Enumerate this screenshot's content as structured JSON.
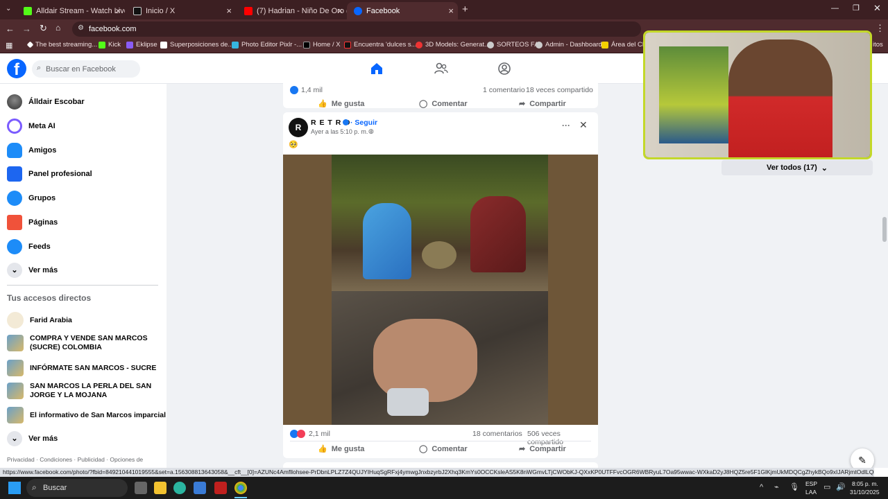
{
  "browser": {
    "tabs": [
      {
        "title": "Alldair Stream - Watch Live on",
        "color": "#53fc18"
      },
      {
        "title": "Inicio / X",
        "color": "#000000"
      },
      {
        "title": "(7) Hadrian - Niño De Oro (Vid",
        "color": "#ff0000"
      },
      {
        "title": "Facebook",
        "color": "#0866ff"
      }
    ],
    "new_tab": "+",
    "url": "facebook.com",
    "bookmarks": [
      "The best streaming...",
      "Kick",
      "Eklipse",
      "Superposiciones de...",
      "Photo Editor Pixlr -...",
      "Home / X",
      "Encuentra 'dulces s...",
      "3D Models: Generat...",
      "SORTEOS FA",
      "Admin - Dashboard",
      "Área del Clie"
    ],
    "bookmarks_overflow": "itos"
  },
  "fb": {
    "search_placeholder": "Buscar en Facebook",
    "nav": [
      "Álldair Escobar",
      "Meta AI",
      "Amigos",
      "Panel profesional",
      "Grupos",
      "Páginas",
      "Feeds",
      "Ver más"
    ],
    "shortcuts_title": "Tus accesos directos",
    "shortcuts": [
      "Farid Arabia",
      "COMPRA Y VENDE SAN MARCOS (SUCRE) COLOMBIA",
      "INFÓRMATE SAN MARCOS - SUCRE",
      "SAN MARCOS LA PERLA DEL SAN JORGE Y LA MOJANA",
      "El informativo de San Marcos imparcial",
      "Ver más"
    ],
    "footer": "Privacidad · Condiciones · Publicidad · Opciones de",
    "prev_post": {
      "reactions": "1,4 mil",
      "comments": "1 comentario",
      "shares": "18 veces compartido"
    },
    "actions": {
      "like": "Me gusta",
      "comment": "Comentar",
      "share": "Compartir"
    },
    "post": {
      "author": "R E T R O",
      "follow": "· Seguir",
      "time": "Ayer a las 5:10 p. m. ·",
      "body": "🥺",
      "reactions": "2,1 mil",
      "comments": "18 comentarios",
      "shares": "506 veces compartido",
      "more": "···",
      "close": "✕"
    },
    "contacts_see_all": "Ver todos (17)"
  },
  "status_url": "https://www.facebook.com/photo/?fbid=849210441019555&set=a.156308813643058&__cft__[0]=AZUNc4Amfllohsee-PrDbnLPLZ7Z4QUJYIHuqSgRFxj4ymwgJnxbzyrbJ2Xhq3KmYs0OCCKsleAS5K8nWGmvLTjCWObKJ-QXxKP0UTFFvcOGR6WBRyuL7Oa95wwac-WXkaD2yJ8HQZ5re5F1GlKjmUkMDQCgZhykBQo9xIJARjmtOdlLQkvyk8t08F4OpFH1KUPkW1H-c...",
  "taskbar": {
    "search": "Buscar",
    "lang": "ESP",
    "lang2": "LAA",
    "time": "8:05 p. m.",
    "date": "31/10/2025"
  },
  "colors": {
    "fb_blue": "#0866ff",
    "chrome_dark": "#3c1f22",
    "overlay_border": "#c3d829"
  }
}
